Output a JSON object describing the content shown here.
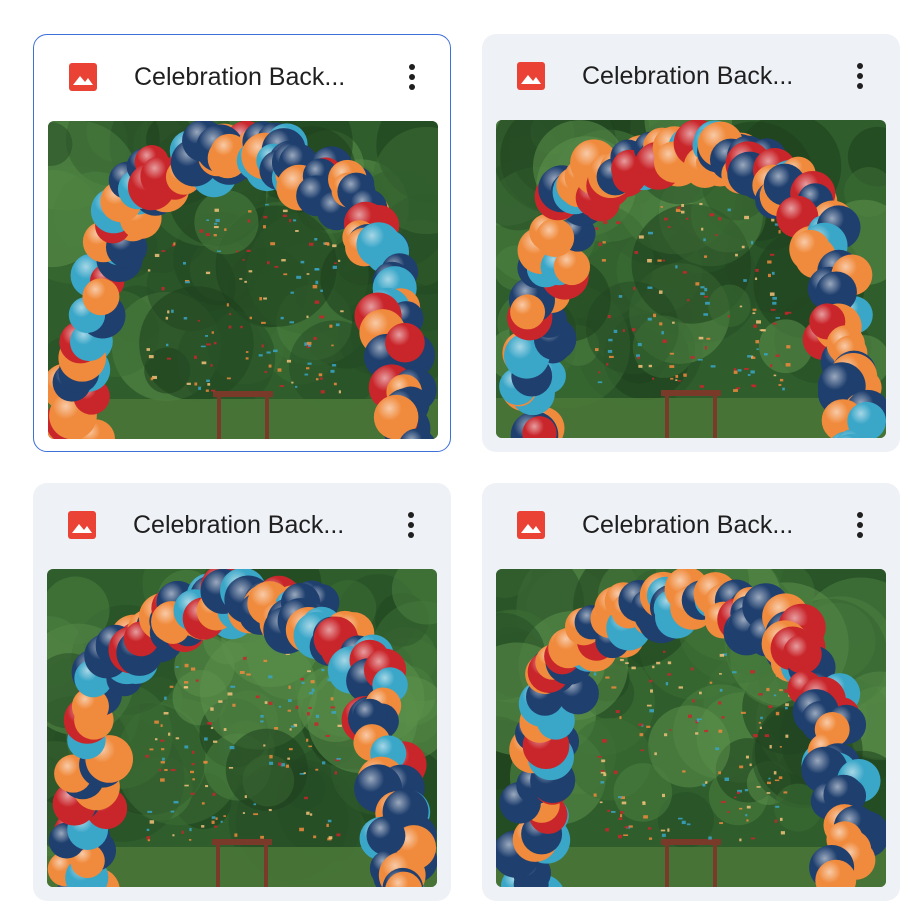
{
  "files": [
    {
      "title": "Celebration Back...",
      "type_icon": "image-icon",
      "selected": true
    },
    {
      "title": "Celebration Back...",
      "type_icon": "image-icon",
      "selected": false
    },
    {
      "title": "Celebration Back...",
      "type_icon": "image-icon",
      "selected": false
    },
    {
      "title": "Celebration Back...",
      "type_icon": "image-icon",
      "selected": false
    }
  ],
  "colors": {
    "icon_red": "#ea4335",
    "card_bg": "#eef1f6",
    "selected_border": "#3d6fd8",
    "balloon_navy": "#1f3f6e",
    "balloon_orange": "#f08a3c",
    "balloon_red": "#c9262b",
    "balloon_teal": "#3aa6c8",
    "foliage": "#2e5a2c"
  }
}
